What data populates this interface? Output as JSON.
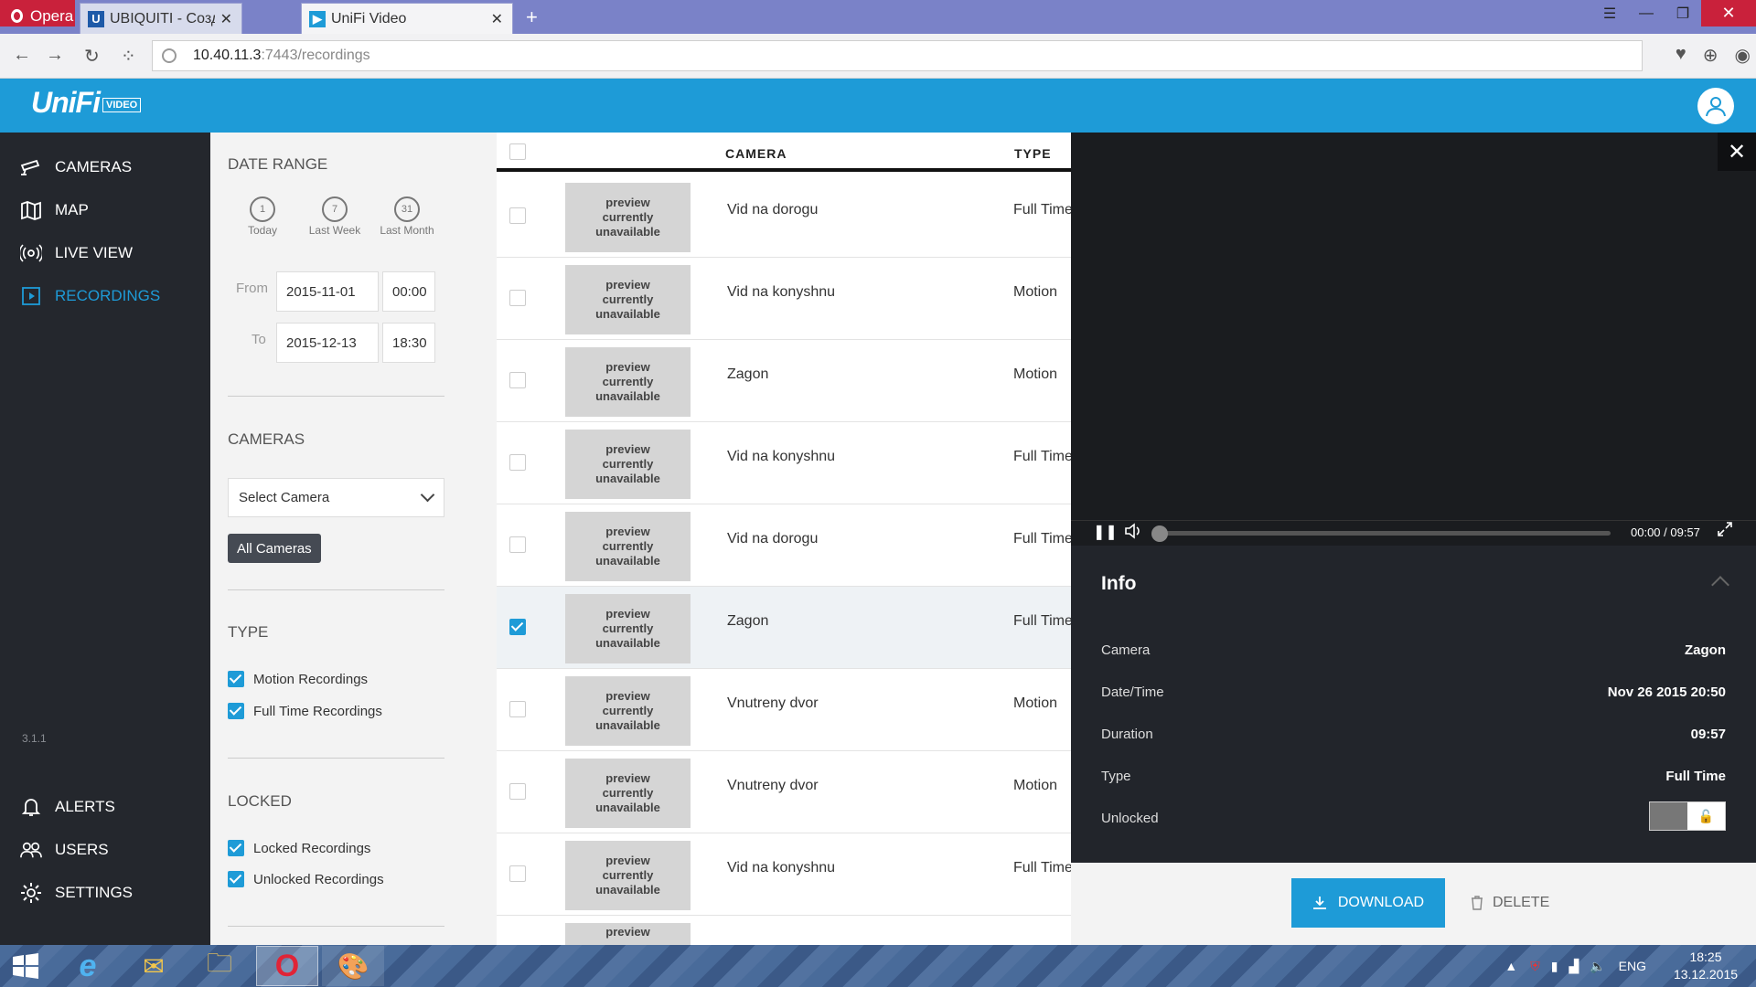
{
  "browser": {
    "opera_label": "Opera",
    "tabs": [
      {
        "title": "UBIQUITI - Создать нову",
        "close": "✕"
      },
      {
        "title": "UniFi Video",
        "close": "✕"
      }
    ],
    "new_tab": "+",
    "url_host": "10.40.11.3",
    "url_path": ":7443/recordings"
  },
  "app": {
    "logo": "UniFi",
    "logo_badge": "VIDEO",
    "accent_color": "#1e9bd7"
  },
  "sidebar": {
    "items": [
      {
        "label": "CAMERAS",
        "icon": "camera-icon"
      },
      {
        "label": "MAP",
        "icon": "map-icon"
      },
      {
        "label": "LIVE VIEW",
        "icon": "live-view-icon"
      },
      {
        "label": "RECORDINGS",
        "icon": "recordings-icon",
        "active": true
      }
    ],
    "version": "3.1.1",
    "bottom_items": [
      {
        "label": "ALERTS",
        "icon": "bell-icon"
      },
      {
        "label": "USERS",
        "icon": "users-icon"
      },
      {
        "label": "SETTINGS",
        "icon": "gear-icon"
      }
    ]
  },
  "filters": {
    "date_range_title": "DATE RANGE",
    "shortcuts": [
      {
        "num": "1",
        "label": "Today"
      },
      {
        "num": "7",
        "label": "Last Week"
      },
      {
        "num": "31",
        "label": "Last Month"
      }
    ],
    "from_label": "From",
    "from_date": "2015-11-01",
    "from_time": "00:00",
    "to_label": "To",
    "to_date": "2015-12-13",
    "to_time": "18:30",
    "cameras_title": "CAMERAS",
    "select_camera": "Select Camera",
    "all_cameras": "All Cameras",
    "type_title": "TYPE",
    "motion_recordings": "Motion Recordings",
    "full_time_recordings": "Full Time Recordings",
    "locked_title": "LOCKED",
    "locked_recordings": "Locked Recordings",
    "unlocked_recordings": "Unlocked Recordings"
  },
  "table": {
    "col_camera": "CAMERA",
    "col_type": "TYPE",
    "preview_text": "preview currently unavailable",
    "rows": [
      {
        "camera": "Vid na dorogu",
        "type": "Full Time",
        "checked": false
      },
      {
        "camera": "Vid na konyshnu",
        "type": "Motion",
        "checked": false
      },
      {
        "camera": "Zagon",
        "type": "Motion",
        "checked": false
      },
      {
        "camera": "Vid na konyshnu",
        "type": "Full Time",
        "checked": false
      },
      {
        "camera": "Vid na dorogu",
        "type": "Full Time",
        "checked": false
      },
      {
        "camera": "Zagon",
        "type": "Full Time",
        "checked": true
      },
      {
        "camera": "Vnutreny dvor",
        "type": "Motion",
        "checked": false
      },
      {
        "camera": "Vnutreny dvor",
        "type": "Motion",
        "checked": false
      },
      {
        "camera": "Vid na konyshnu",
        "type": "Full Time",
        "checked": false
      }
    ],
    "partial_row_preview": "preview"
  },
  "player": {
    "time": "00:00 / 09:57",
    "progress_fraction": 0.0
  },
  "info": {
    "title": "Info",
    "camera_label": "Camera",
    "camera_value": "Zagon",
    "datetime_label": "Date/Time",
    "datetime_value": "Nov 26 2015 20:50",
    "duration_label": "Duration",
    "duration_value": "09:57",
    "type_label": "Type",
    "type_value": "Full Time",
    "unlocked_label": "Unlocked"
  },
  "actions": {
    "download": "DOWNLOAD",
    "delete": "DELETE"
  },
  "taskbar": {
    "lang": "ENG",
    "time": "18:25",
    "date": "13.12.2015"
  }
}
